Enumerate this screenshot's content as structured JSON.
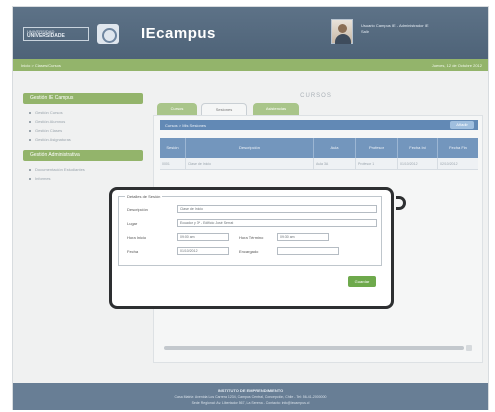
{
  "header": {
    "logo_line1": "UNIVERSIDAD",
    "logo_line2": "UNIVERSIDADE",
    "app_title": "IEcampus",
    "user_line1": "Usuario Campus IE - Administrador IE",
    "user_line2": "Salir"
  },
  "subbar": {
    "breadcrumb": "Inicio > Clases/Cursos",
    "date": "Jueves, 12 de Octubre 2012"
  },
  "sidebar": {
    "section1": {
      "title": "Gestión IE Campus",
      "items": [
        {
          "label": "Gestión Cursos"
        },
        {
          "label": "Gestión Alumnos"
        },
        {
          "label": "Gestión Clases"
        },
        {
          "label": "Gestión Asignaturas"
        }
      ]
    },
    "section2": {
      "title": "Gestión Administrativa",
      "items": [
        {
          "label": "Documentación Estudiantes"
        },
        {
          "label": "Informes"
        }
      ]
    }
  },
  "main": {
    "title": "CURSOS",
    "tabs": [
      {
        "label": "Cursos"
      },
      {
        "label": "Sesiones"
      },
      {
        "label": "Asistencias"
      }
    ],
    "toolbar": {
      "label": "Cursos > Mis Sesiones",
      "button": "Añadir"
    },
    "table": {
      "headers": [
        "Sesión",
        "Descripción",
        "Aula",
        "Profesor",
        "Fecha Ini",
        "Fecha Fin"
      ],
      "rows": [
        [
          "0001",
          "Clase de Inicio",
          "Aula 3A",
          "Profesor 1",
          "01/10/2012",
          "02/10/2012"
        ]
      ]
    }
  },
  "modal": {
    "legend": "Detalles de Sesión",
    "fields": {
      "descripcion_label": "Descripción",
      "descripcion_value": "Clase de Inicio",
      "lugar_label": "Lugar",
      "lugar_value": "Ecuador y 3ª - Edificio José Serrat",
      "hora_inicio_label": "Hora Inicio",
      "hora_inicio_value": "09:00 am",
      "hora_termino_label": "Hora Término",
      "hora_termino_value": "09:30 am",
      "fecha_label": "Fecha",
      "fecha_value": "01/10/2012",
      "encargado_label": "Encargado",
      "encargado_value": ""
    },
    "save_label": "Guardar"
  },
  "footer": {
    "line1": "INSTITUTO DE EMPRENDIMIENTO",
    "line2": "Casa Matriz: Avenida Los Carrera 1234, Campus Central, Concepción, Chile - Tel: 56-41-2000000",
    "line3": "Sede Regional: Av. Libertador 567, La Serena - Contacto: info@iecampus.cl"
  }
}
